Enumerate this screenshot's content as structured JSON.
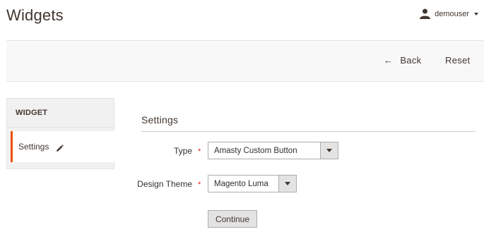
{
  "header": {
    "page_title": "Widgets",
    "user_name": "demouser"
  },
  "actions": {
    "back_label": "Back",
    "back_arrow": "←",
    "reset_label": "Reset"
  },
  "sidebar": {
    "title": "WIDGET",
    "items": [
      {
        "label": "Settings",
        "icon": "pencil-icon",
        "active": true
      }
    ]
  },
  "form": {
    "section_title": "Settings",
    "fields": {
      "type": {
        "label": "Type",
        "required_mark": "*",
        "value": "Amasty Custom Button"
      },
      "design_theme": {
        "label": "Design Theme",
        "required_mark": "*",
        "value": "Magento Luma"
      }
    },
    "continue_label": "Continue"
  },
  "colors": {
    "accent": "#eb5202",
    "required": "#e22626",
    "text": "#41362f",
    "action_bar_bg": "#f8f8f8"
  }
}
